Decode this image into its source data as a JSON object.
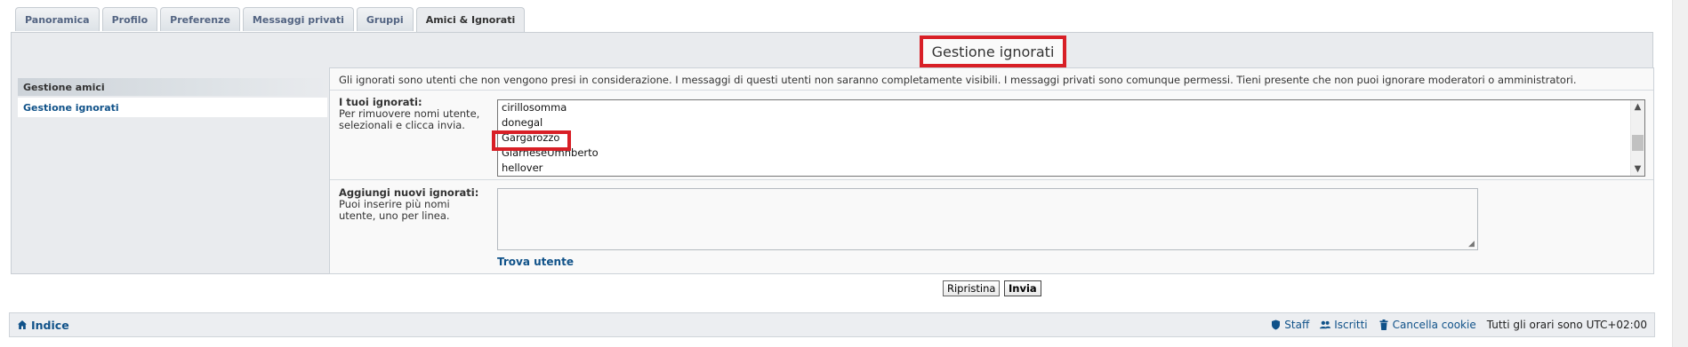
{
  "tabs": [
    "Panoramica",
    "Profilo",
    "Preferenze",
    "Messaggi privati",
    "Gruppi",
    "Amici & Ignorati"
  ],
  "active_tab": "Amici & Ignorati",
  "section_title": "Gestione ignorati",
  "menu": {
    "header": "Gestione amici",
    "active_item": "Gestione ignorati"
  },
  "intro_text": "Gli ignorati sono utenti che non vengono presi in considerazione. I messaggi di questi utenti non saranno completamente visibili. I messaggi privati sono comunque permessi. Tieni presente che non puoi ignorare moderatori o amministratori.",
  "ignored": {
    "label": "I tuoi ignorati:",
    "hint": "Per rimuovere nomi utente, selezionali e clicca invia.",
    "users": [
      "cirillosomma",
      "donegal",
      "Gargarozzo",
      "GiarneseUmnberto",
      "hellover"
    ]
  },
  "add_ignored": {
    "label": "Aggiungi nuovi ignorati:",
    "hint": "Puoi inserire più nomi utente, uno per linea.",
    "value": ""
  },
  "find_user": "Trova utente",
  "buttons": {
    "reset": "Ripristina",
    "submit": "Invia"
  },
  "footer": {
    "index": "Indice",
    "staff": "Staff",
    "members": "Iscritti",
    "delete_cookies": "Cancella cookie",
    "timezone": "Tutti gli orari sono UTC+02:00"
  },
  "colors": {
    "highlight": "#d81f26",
    "link": "#105289"
  }
}
